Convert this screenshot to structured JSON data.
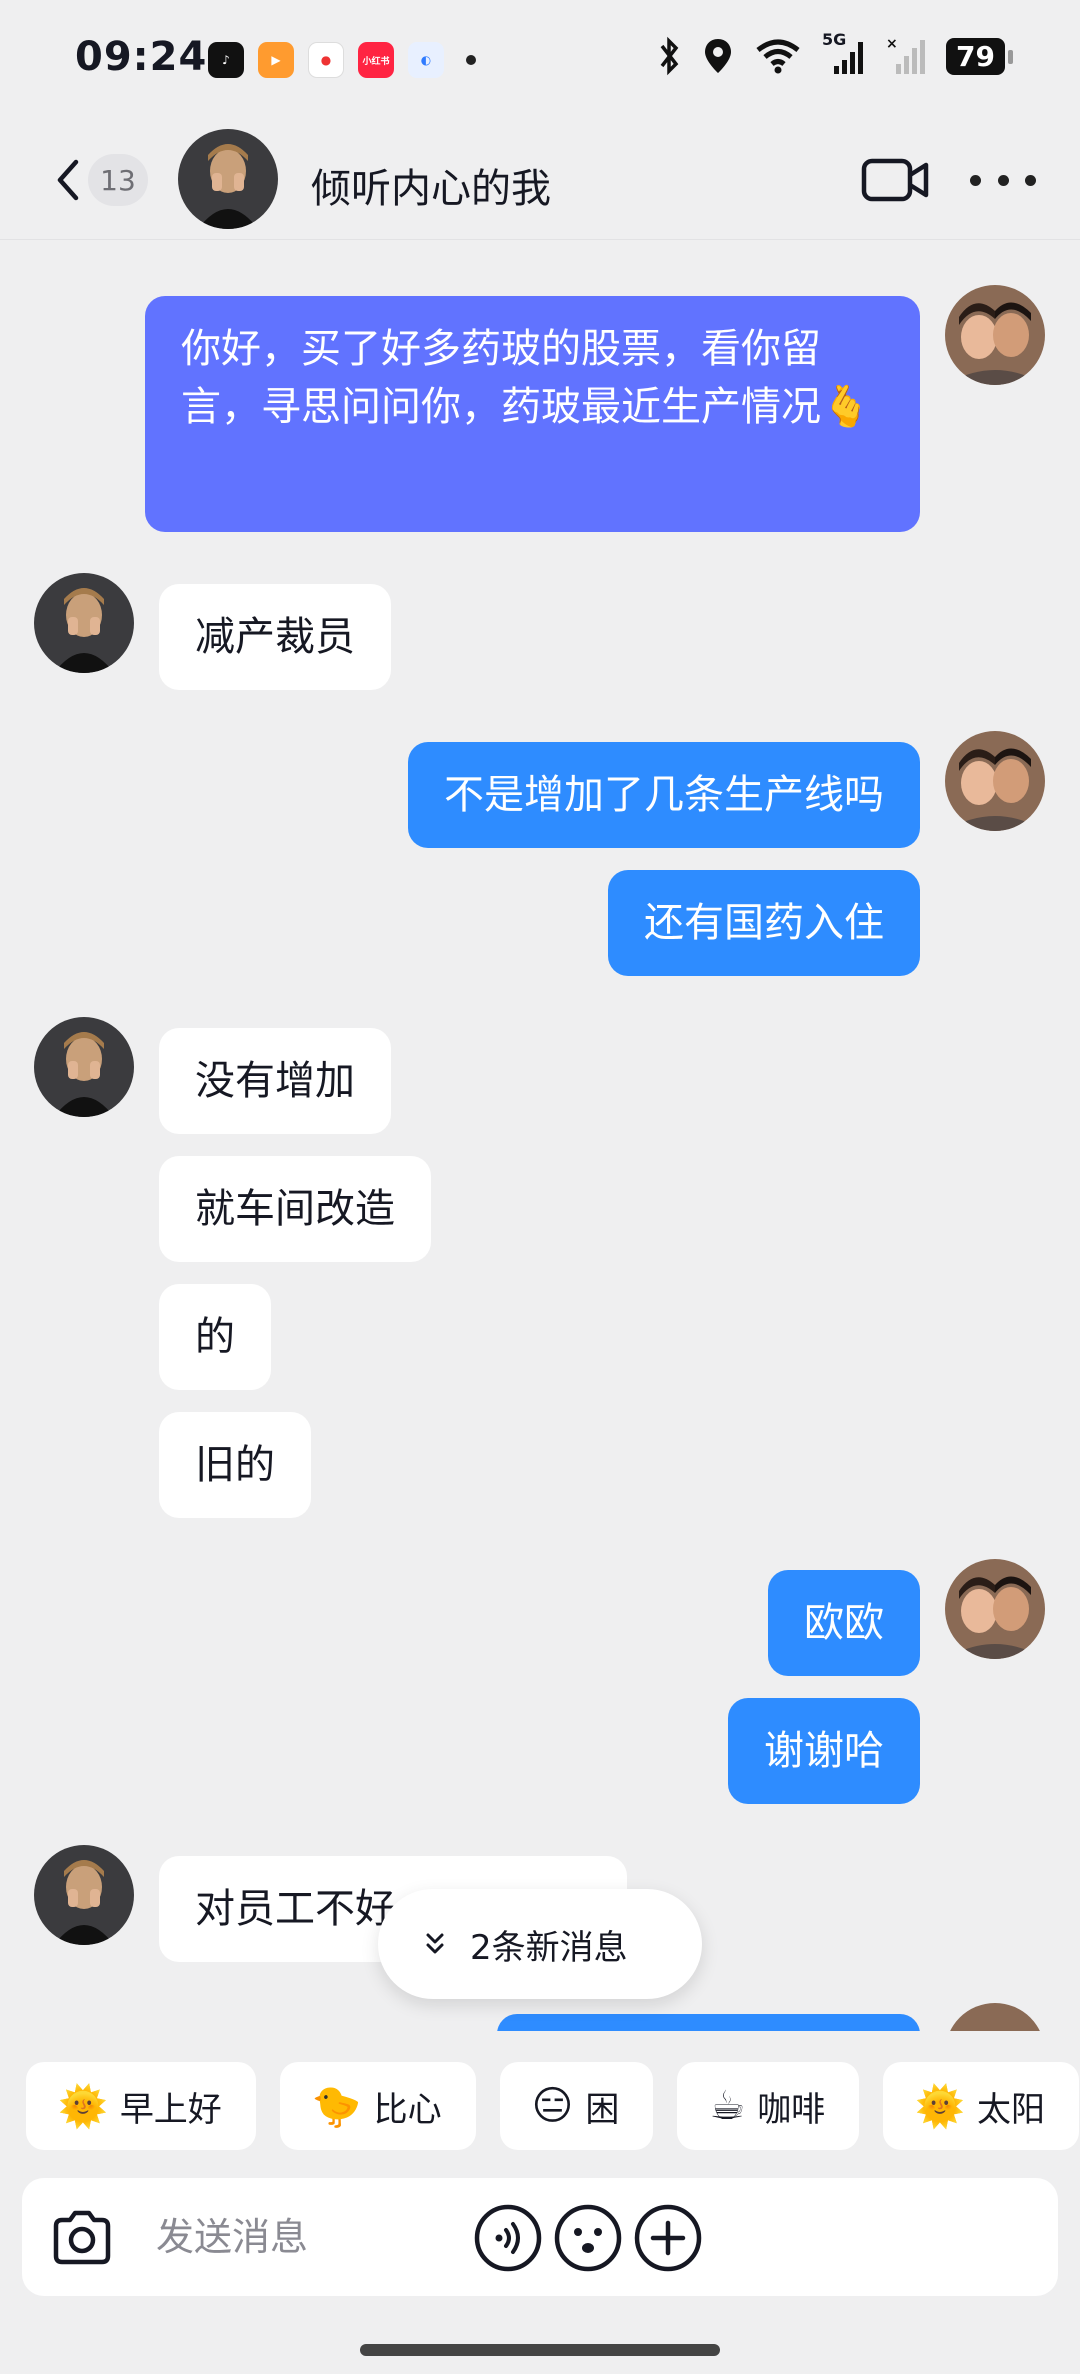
{
  "status_bar": {
    "time": "09:24",
    "battery": "79",
    "network": "5G",
    "icons": [
      "tiktok-icon",
      "video-app-icon",
      "douyin-map-icon",
      "xiaohongshu-icon",
      "browser-icon"
    ],
    "xhs_label": "小红书"
  },
  "header": {
    "unread_count": "13",
    "title": "倾听内心的我"
  },
  "messages": [
    {
      "side": "out",
      "text": "你好，买了好多药玻的股票，看你留言，寻思问问你，药玻最近生产情况🫰"
    },
    {
      "side": "in",
      "text": "减产裁员"
    },
    {
      "side": "out",
      "text": "不是增加了几条生产线吗"
    },
    {
      "side": "out",
      "text": "还有国药入住"
    },
    {
      "side": "in",
      "text": "没有增加"
    },
    {
      "side": "in",
      "text": "就车间改造"
    },
    {
      "side": "in",
      "text": "的"
    },
    {
      "side": "in",
      "text": "旧的"
    },
    {
      "side": "out",
      "text": "欧欧"
    },
    {
      "side": "out",
      "text": "谢谢哈"
    },
    {
      "side": "in",
      "text": "对员工不好"
    }
  ],
  "new_messages_label": "2条新消息",
  "quick_replies": [
    {
      "emoji": "🌞",
      "label": "早上好"
    },
    {
      "emoji": "🐤",
      "label": "比心"
    },
    {
      "emoji": "😑",
      "label": "困"
    },
    {
      "emoji": "☕",
      "label": "咖啡"
    },
    {
      "emoji": "🌞",
      "label": "太阳"
    }
  ],
  "input": {
    "placeholder": "发送消息"
  },
  "colors": {
    "outgoing_bubble": "#2e8cff",
    "outgoing_first_bubble": "#6173ff",
    "incoming_bubble": "#ffffff",
    "background": "#efeff0"
  }
}
